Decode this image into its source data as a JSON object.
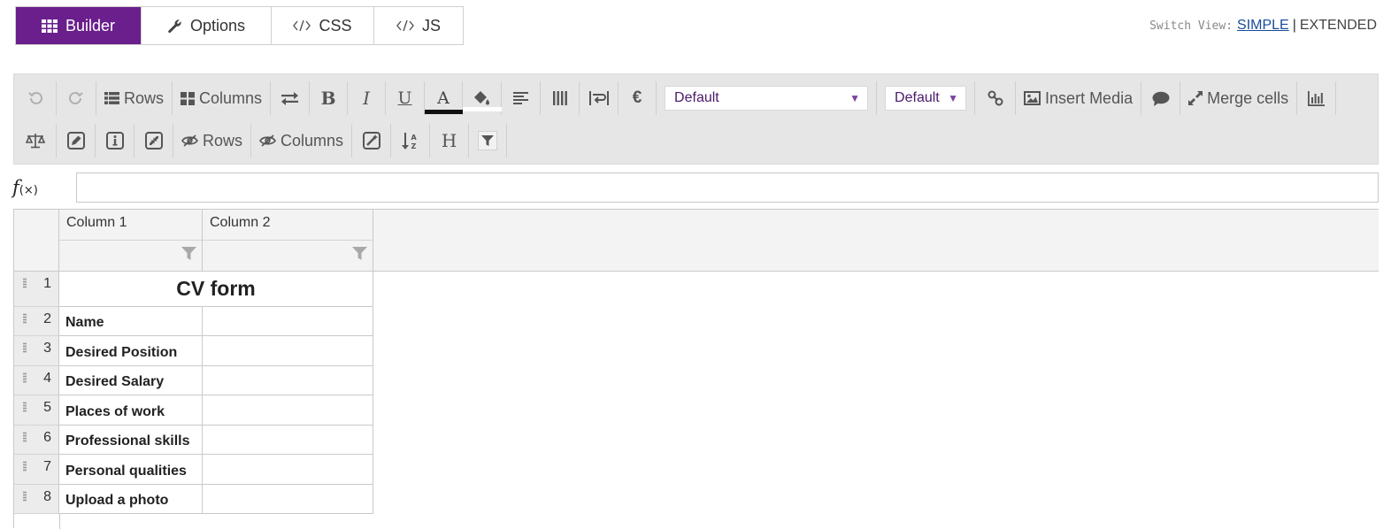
{
  "tabs": {
    "builder": "Builder",
    "options": "Options",
    "css": "CSS",
    "js": "JS"
  },
  "switch_view": {
    "label": "Switch View:",
    "simple": "SIMPLE",
    "separator": "|",
    "extended": "EXTENDED"
  },
  "toolbar": {
    "rows_label": "Rows",
    "columns_label": "Columns",
    "bold": "B",
    "italic": "I",
    "underline": "U",
    "font_color": "A",
    "currency": "€",
    "font_select": "Default",
    "size_select": "Default",
    "insert_media": "Insert Media",
    "merge_cells": "Merge cells",
    "hide_rows": "Rows",
    "hide_columns": "Columns",
    "header": "H",
    "accent_color": "#6a1f8c"
  },
  "formula": {
    "label": "f",
    "sub": "(×)",
    "value": ""
  },
  "sheet": {
    "columns": [
      "Column 1",
      "Column 2"
    ],
    "rows": [
      {
        "num": "1",
        "c1": "CV form",
        "c2": ""
      },
      {
        "num": "2",
        "c1": "Name",
        "c2": ""
      },
      {
        "num": "3",
        "c1": "Desired Position",
        "c2": ""
      },
      {
        "num": "4",
        "c1": "Desired Salary",
        "c2": ""
      },
      {
        "num": "5",
        "c1": "Places of work",
        "c2": ""
      },
      {
        "num": "6",
        "c1": "Professional skills",
        "c2": ""
      },
      {
        "num": "7",
        "c1": "Personal qualities",
        "c2": ""
      },
      {
        "num": "8",
        "c1": "Upload a photo",
        "c2": ""
      }
    ]
  }
}
